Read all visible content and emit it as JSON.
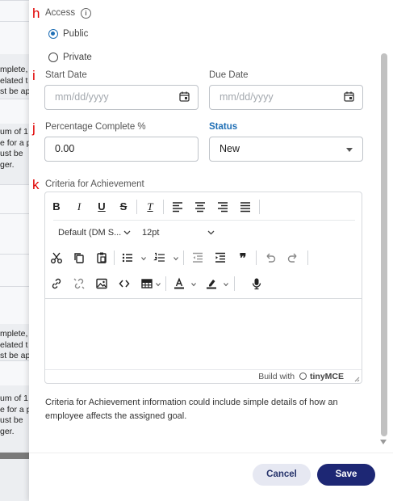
{
  "background": {
    "rows": [
      {
        "lines": [
          "mplete,",
          "elated t",
          "st be ap"
        ]
      },
      {
        "lines": [
          "um of 1",
          "e for a p",
          "ust be",
          "ger."
        ]
      },
      {
        "lines": [
          "mplete,",
          "elated t",
          "st be ap"
        ]
      },
      {
        "lines": [
          "um of 1",
          "e for a p",
          "ust be",
          "ger."
        ]
      }
    ]
  },
  "markers": {
    "h": "h",
    "i": "i",
    "j": "j",
    "k": "k"
  },
  "access": {
    "label": "Access",
    "info_icon": "i",
    "options": [
      {
        "label": "Public",
        "checked": true
      },
      {
        "label": "Private",
        "checked": false
      }
    ]
  },
  "start_date": {
    "label": "Start Date",
    "placeholder": "mm/dd/yyyy"
  },
  "due_date": {
    "label": "Due Date",
    "placeholder": "mm/dd/yyyy"
  },
  "percentage": {
    "label": "Percentage Complete %",
    "value": "0.00"
  },
  "status": {
    "label": "Status",
    "value": "New"
  },
  "criteria": {
    "label": "Criteria for Achievement",
    "font_family_select": "Default (DM S...",
    "font_size_select": "12pt",
    "toolbar_icons": [
      "bold-icon",
      "italic-icon",
      "underline-icon",
      "strikethrough-icon",
      "clear-formatting-icon",
      "align-left-icon",
      "align-center-icon",
      "align-right-icon",
      "justify-icon",
      "cut-icon",
      "copy-icon",
      "paste-icon",
      "bullet-list-icon",
      "numbered-list-icon",
      "outdent-icon",
      "indent-icon",
      "blockquote-icon",
      "undo-icon",
      "redo-icon",
      "link-icon",
      "unlink-icon",
      "image-icon",
      "code-icon",
      "table-icon",
      "text-color-icon",
      "highlight-color-icon",
      "microphone-icon"
    ],
    "build_with": "Build with",
    "brand": "tinyMCE"
  },
  "help_text": "Criteria for Achievement information could include simple details of how an employee affects the assigned goal.",
  "buttons": {
    "cancel": "Cancel",
    "save": "Save"
  },
  "colors": {
    "accent": "#1f6fb5",
    "primary_button": "#1d2774",
    "secondary_button": "#e6e8f2",
    "marker": "#e00000"
  }
}
